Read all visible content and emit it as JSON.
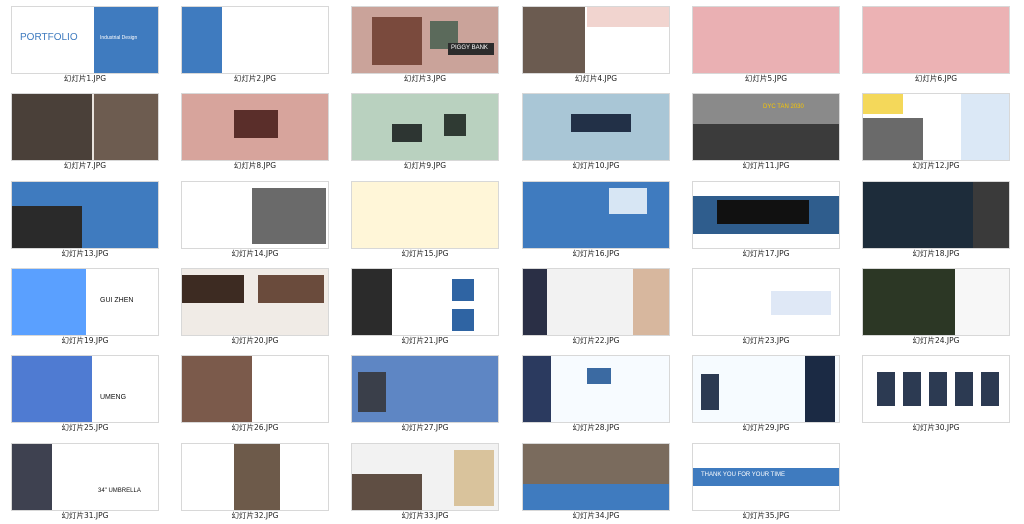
{
  "colors": {
    "background": "#ffffff",
    "accent_blue": "#3f7bbf",
    "pink": "#ebb3b5",
    "green": "#b9d1bf",
    "light_blue": "#a9c6d6"
  },
  "slides": [
    {
      "file": "幻灯片1.JPG",
      "text": [
        "PORTFOLIO",
        "Industrial Design"
      ]
    },
    {
      "file": "幻灯片2.JPG",
      "text": []
    },
    {
      "file": "幻灯片3.JPG",
      "text": [
        "PIGGY BANK"
      ]
    },
    {
      "file": "幻灯片4.JPG",
      "text": []
    },
    {
      "file": "幻灯片5.JPG",
      "text": []
    },
    {
      "file": "幻灯片6.JPG",
      "text": []
    },
    {
      "file": "幻灯片7.JPG",
      "text": []
    },
    {
      "file": "幻灯片8.JPG",
      "text": []
    },
    {
      "file": "幻灯片9.JPG",
      "text": []
    },
    {
      "file": "幻灯片10.JPG",
      "text": []
    },
    {
      "file": "幻灯片11.JPG",
      "text": [
        "DYC TAN 2030"
      ]
    },
    {
      "file": "幻灯片12.JPG",
      "text": []
    },
    {
      "file": "幻灯片13.JPG",
      "text": []
    },
    {
      "file": "幻灯片14.JPG",
      "text": []
    },
    {
      "file": "幻灯片15.JPG",
      "text": []
    },
    {
      "file": "幻灯片16.JPG",
      "text": []
    },
    {
      "file": "幻灯片17.JPG",
      "text": []
    },
    {
      "file": "幻灯片18.JPG",
      "text": []
    },
    {
      "file": "幻灯片19.JPG",
      "text": [
        "GUI ZHEN"
      ]
    },
    {
      "file": "幻灯片20.JPG",
      "text": []
    },
    {
      "file": "幻灯片21.JPG",
      "text": []
    },
    {
      "file": "幻灯片22.JPG",
      "text": []
    },
    {
      "file": "幻灯片23.JPG",
      "text": []
    },
    {
      "file": "幻灯片24.JPG",
      "text": []
    },
    {
      "file": "幻灯片25.JPG",
      "text": [
        "UMENG"
      ]
    },
    {
      "file": "幻灯片26.JPG",
      "text": []
    },
    {
      "file": "幻灯片27.JPG",
      "text": []
    },
    {
      "file": "幻灯片28.JPG",
      "text": []
    },
    {
      "file": "幻灯片29.JPG",
      "text": []
    },
    {
      "file": "幻灯片30.JPG",
      "text": []
    },
    {
      "file": "幻灯片31.JPG",
      "text": [
        "34\" UMBRELLA"
      ]
    },
    {
      "file": "幻灯片32.JPG",
      "text": []
    },
    {
      "file": "幻灯片33.JPG",
      "text": []
    },
    {
      "file": "幻灯片34.JPG",
      "text": []
    },
    {
      "file": "幻灯片35.JPG",
      "text": [
        "THANK YOU FOR YOUR TIME"
      ]
    }
  ]
}
